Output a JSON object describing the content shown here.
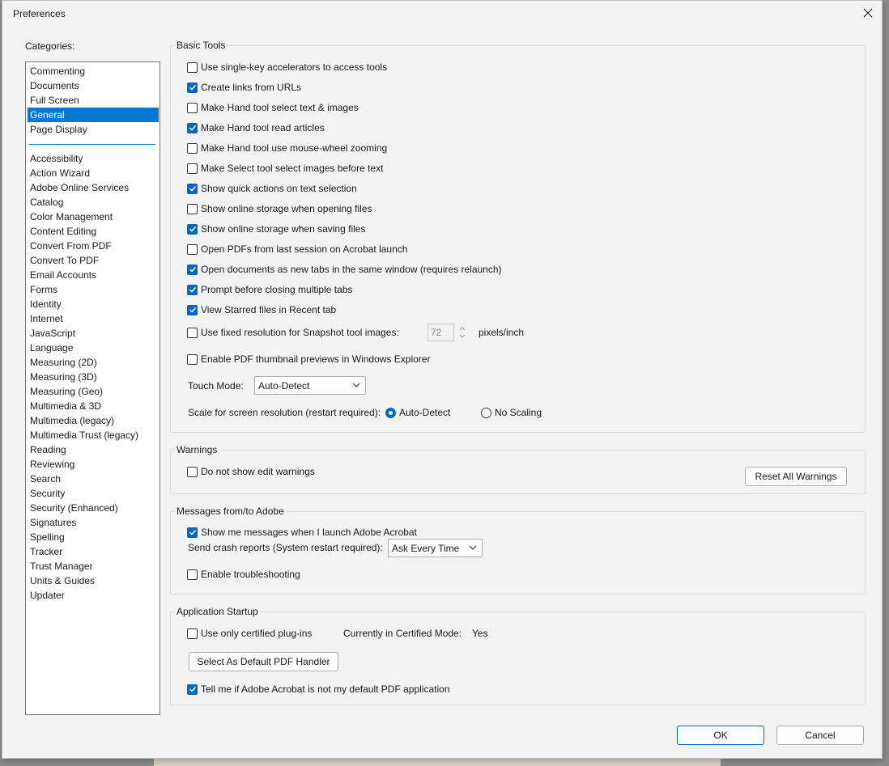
{
  "window": {
    "title": "Preferences"
  },
  "categories": {
    "label": "Categories:",
    "top_items": [
      "Commenting",
      "Documents",
      "Full Screen",
      "General",
      "Page Display"
    ],
    "selected": "General",
    "items": [
      "Accessibility",
      "Action Wizard",
      "Adobe Online Services",
      "Catalog",
      "Color Management",
      "Content Editing",
      "Convert From PDF",
      "Convert To PDF",
      "Email Accounts",
      "Forms",
      "Identity",
      "Internet",
      "JavaScript",
      "Language",
      "Measuring (2D)",
      "Measuring (3D)",
      "Measuring (Geo)",
      "Multimedia & 3D",
      "Multimedia (legacy)",
      "Multimedia Trust (legacy)",
      "Reading",
      "Reviewing",
      "Search",
      "Security",
      "Security (Enhanced)",
      "Signatures",
      "Spelling",
      "Tracker",
      "Trust Manager",
      "Units & Guides",
      "Updater"
    ]
  },
  "basic_tools": {
    "title": "Basic Tools",
    "options": [
      {
        "label": "Use single-key accelerators to access tools",
        "checked": false
      },
      {
        "label": "Create links from URLs",
        "checked": true
      },
      {
        "label": "Make Hand tool select text & images",
        "checked": false
      },
      {
        "label": "Make Hand tool read articles",
        "checked": true
      },
      {
        "label": "Make Hand tool use mouse-wheel zooming",
        "checked": false
      },
      {
        "label": "Make Select tool select images before text",
        "checked": false
      },
      {
        "label": "Show quick actions on text selection",
        "checked": true
      },
      {
        "label": "Show online storage when opening files",
        "checked": false
      },
      {
        "label": "Show online storage when saving files",
        "checked": true
      },
      {
        "label": "Open PDFs from last session on Acrobat launch",
        "checked": false
      },
      {
        "label": "Open documents as new tabs in the same window (requires relaunch)",
        "checked": true
      },
      {
        "label": "Prompt before closing multiple tabs",
        "checked": true
      },
      {
        "label": "View Starred files in Recent tab",
        "checked": true
      }
    ],
    "snapshot": {
      "label": "Use fixed resolution for Snapshot tool images:",
      "checked": false,
      "value": "72",
      "unit": "pixels/inch"
    },
    "thumbnail": {
      "label": "Enable PDF thumbnail previews in Windows Explorer",
      "checked": false
    },
    "touch_mode": {
      "label": "Touch Mode:",
      "value": "Auto-Detect"
    },
    "scale": {
      "label": "Scale for screen resolution (restart required):",
      "option1": "Auto-Detect",
      "option2": "No Scaling",
      "selected": "Auto-Detect"
    }
  },
  "warnings": {
    "title": "Warnings",
    "no_edit": {
      "label": "Do not show edit warnings",
      "checked": false
    },
    "reset_button": "Reset All Warnings"
  },
  "messages": {
    "title": "Messages from/to Adobe",
    "show_messages": {
      "label": "Show me messages when I launch Adobe Acrobat",
      "checked": true
    },
    "crash_label": "Send crash reports (System restart required):",
    "crash_value": "Ask Every Time",
    "troubleshooting": {
      "label": "Enable troubleshooting",
      "checked": false
    }
  },
  "startup": {
    "title": "Application Startup",
    "certified": {
      "label": "Use only certified plug-ins",
      "checked": false
    },
    "mode_label": "Currently in Certified Mode:",
    "mode_value": "Yes",
    "default_handler_button": "Select As Default PDF Handler",
    "tell_me": {
      "label": "Tell me if Adobe Acrobat is not my default PDF application",
      "checked": true
    }
  },
  "footer": {
    "ok": "OK",
    "cancel": "Cancel"
  }
}
